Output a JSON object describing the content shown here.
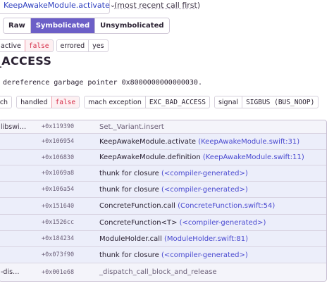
{
  "header": {
    "thread_name": "KeepAwakeModule.activate",
    "most_recent": "(most recent call first)"
  },
  "views": [
    "Raw",
    "Symbolicated",
    "Unsymbolicated"
  ],
  "state_tags": [
    {
      "key": "active",
      "value": "false"
    },
    {
      "key": "errored",
      "value": "yes"
    }
  ],
  "exception": {
    "type": "_ACCESS",
    "message": "dereference garbage pointer 0x8000000000000030.",
    "mechanism_tags": [
      {
        "key": "ach",
        "value": ""
      },
      {
        "key": "handled",
        "value": "false"
      },
      {
        "key": "mach exception",
        "value": "EXC_BAD_ACCESS"
      },
      {
        "key": "signal",
        "value": "SIGBUS (BUS_NOOP)"
      }
    ]
  },
  "frames": [
    {
      "package": "libswi…",
      "address": "+0x119390",
      "function": "Set._Variant.insert",
      "location": ""
    },
    {
      "package": "",
      "address": "+0x106954",
      "function": "KeepAwakeModule.activate",
      "location": "(KeepAwakeModule.swift:31)"
    },
    {
      "package": "",
      "address": "+0x106830",
      "function": "KeepAwakeModule.definition",
      "location": "(KeepAwakeModule.swift:11)"
    },
    {
      "package": "",
      "address": "+0x1069a8",
      "function": "thunk for closure",
      "location": "(<compiler-generated>)"
    },
    {
      "package": "",
      "address": "+0x106a54",
      "function": "thunk for closure",
      "location": "(<compiler-generated>)"
    },
    {
      "package": "",
      "address": "+0x151640",
      "function": "ConcreteFunction.call",
      "location": "(ConcreteFunction.swift:54)"
    },
    {
      "package": "",
      "address": "+0x1526cc",
      "function": "ConcreteFunction<T>",
      "location": "(<compiler-generated>)"
    },
    {
      "package": "",
      "address": "+0x184234",
      "function": "ModuleHolder.call",
      "location": "(ModuleHolder.swift:81)"
    },
    {
      "package": "",
      "address": "+0x073f90",
      "function": "thunk for closure",
      "location": "(<compiler-generated>)"
    },
    {
      "package": "-dis…",
      "address": "+0x001e68",
      "function": "_dispatch_call_block_and_release",
      "location": ""
    }
  ],
  "colors": {
    "accent": "#6c5fc7",
    "link": "#4a4ad0",
    "error": "#d6304a"
  },
  "icons": {
    "dropdown": "chevron-down-icon"
  }
}
